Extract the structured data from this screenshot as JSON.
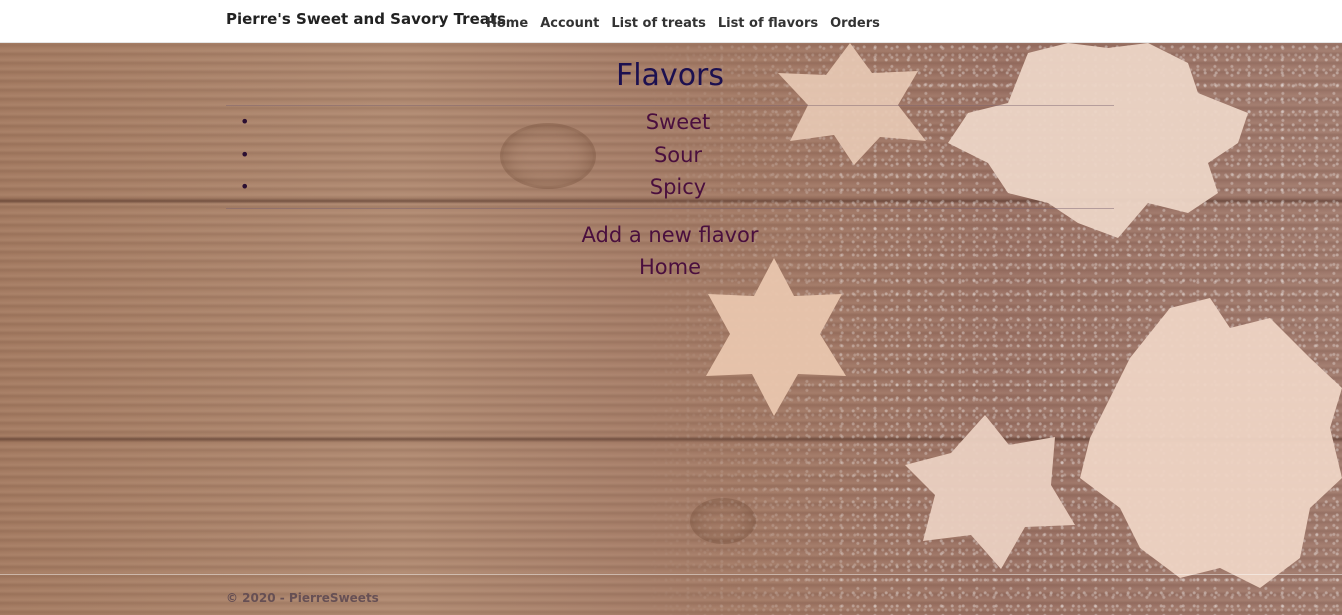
{
  "header": {
    "brand": "Pierre's Sweet and Savory Treats",
    "nav": [
      {
        "label": "Home"
      },
      {
        "label": "Account"
      },
      {
        "label": "List of treats"
      },
      {
        "label": "List of flavors"
      },
      {
        "label": "Orders"
      }
    ]
  },
  "main": {
    "title": "Flavors",
    "flavors": [
      {
        "name": "Sweet"
      },
      {
        "name": "Sour"
      },
      {
        "name": "Spicy"
      }
    ],
    "add_link": "Add a new flavor",
    "home_link": "Home"
  },
  "footer": {
    "text": "© 2020 - PierreSweets"
  },
  "colors": {
    "title": "#1c1050",
    "link": "#4a0f3e",
    "header_bg": "#ffffff"
  },
  "icons": {
    "bullet": "•",
    "cookie": "cookie-icon"
  }
}
